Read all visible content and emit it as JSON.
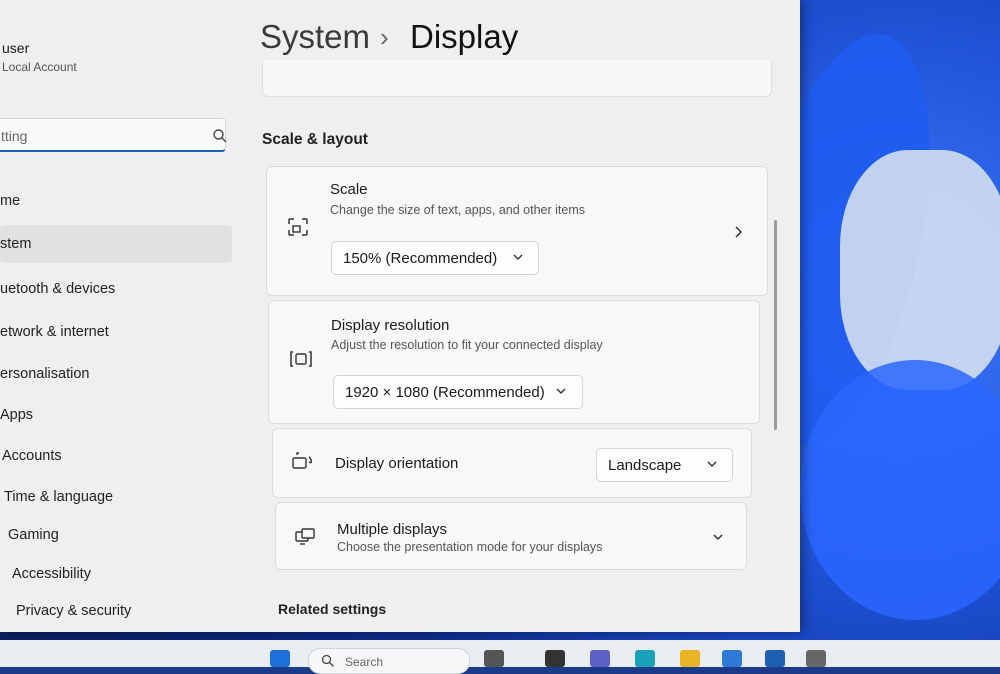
{
  "user": {
    "name": "user",
    "account_type": "Local Account"
  },
  "search": {
    "value": "tting"
  },
  "nav": [
    {
      "label": "me"
    },
    {
      "label": "stem"
    },
    {
      "label": "uetooth & devices"
    },
    {
      "label": "etwork & internet"
    },
    {
      "label": "ersonalisation"
    },
    {
      "label": "Apps"
    },
    {
      "label": "Accounts"
    },
    {
      "label": "Time & language"
    },
    {
      "label": "Gaming"
    },
    {
      "label": "Accessibility"
    },
    {
      "label": "Privacy & security"
    }
  ],
  "breadcrumb": {
    "parent": "System",
    "separator": "›",
    "current": "Display"
  },
  "sections": {
    "scale_layout": "Scale & layout",
    "related": "Related settings"
  },
  "scale": {
    "title": "Scale",
    "desc": "Change the size of text, apps, and other items",
    "value": "150% (Recommended)"
  },
  "resolution": {
    "title": "Display resolution",
    "desc": "Adjust the resolution to fit your connected display",
    "value": "1920 × 1080 (Recommended)"
  },
  "orientation": {
    "title": "Display orientation",
    "value": "Landscape"
  },
  "multiple": {
    "title": "Multiple displays",
    "desc": "Choose the presentation mode for your displays"
  },
  "taskbar": {
    "search_placeholder": "Search"
  },
  "colors": {
    "accent": "#1a5fb4",
    "window_bg": "#efefef",
    "card_bg": "#f8f8f8"
  }
}
